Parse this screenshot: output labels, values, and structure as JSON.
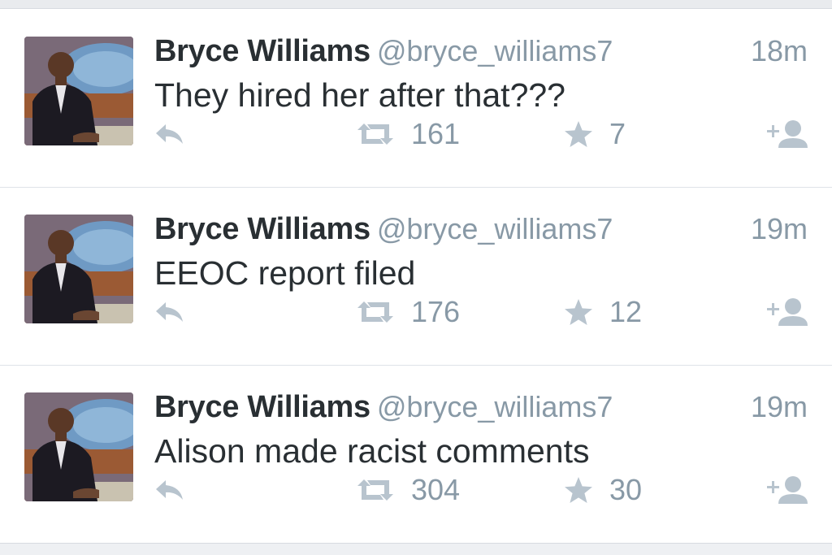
{
  "tweets": [
    {
      "name": "Bryce Williams",
      "handle": "@bryce_williams7",
      "time": "18m",
      "text": "They hired her after that???",
      "retweets": "161",
      "favorites": "7"
    },
    {
      "name": "Bryce Williams",
      "handle": "@bryce_williams7",
      "time": "19m",
      "text": "EEOC report filed",
      "retweets": "176",
      "favorites": "12"
    },
    {
      "name": "Bryce Williams",
      "handle": "@bryce_williams7",
      "time": "19m",
      "text": "Alison made racist comments",
      "retweets": "304",
      "favorites": "30"
    }
  ],
  "icons": {
    "reply": "reply-icon",
    "retweet": "retweet-icon",
    "favorite": "star-icon",
    "follow": "follow-icon"
  },
  "colors": {
    "name": "#292f33",
    "meta": "#8899a6",
    "icon": "#b8c4ce",
    "divider": "#dfe3e8"
  }
}
